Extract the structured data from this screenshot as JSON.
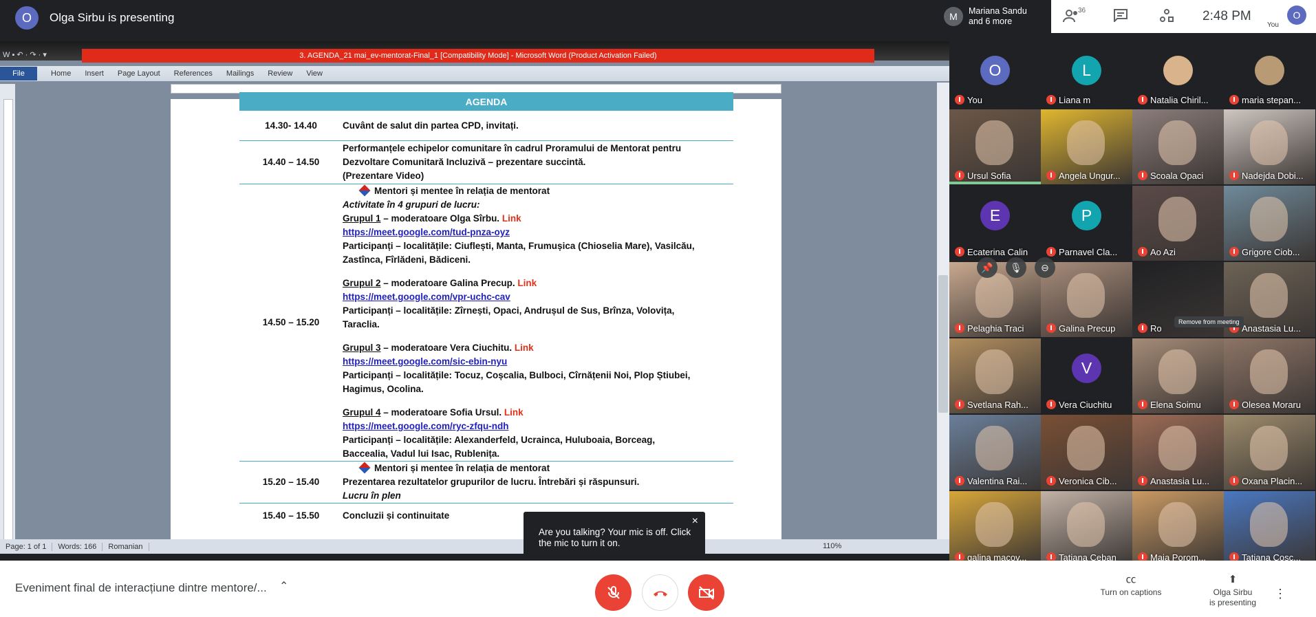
{
  "presenter": {
    "avatar_letter": "O",
    "title": "Olga Sirbu is presenting"
  },
  "header": {
    "joiner_avatar": "M",
    "joiner_line1": "Mariana Sandu",
    "joiner_line2": "and 6 more",
    "people_count": "36",
    "clock": "2:48  PM",
    "you_avatar": "O",
    "you_label": "You",
    "icons": [
      "people-icon",
      "chat-icon",
      "activities-icon"
    ]
  },
  "word": {
    "qat": "W  ▪  ↶ ·  ↷ ·  ▾",
    "title": "3. AGENDA_21 mai_ev-mentorat-Final_1 [Compatibility Mode]  -  Microsoft Word (Product Activation Failed)",
    "tabs": [
      "File",
      "Home",
      "Insert",
      "Page Layout",
      "References",
      "Mailings",
      "Review",
      "View"
    ],
    "status": {
      "page": "Page: 1 of 1",
      "words": "Words: 166",
      "language": "Romanian",
      "zoom": "110%"
    }
  },
  "agenda": {
    "heading": "AGENDA",
    "r1_time": "14.30- 14.40",
    "r1_text": "Cuvânt de salut din partea CPD, invitați.",
    "r2_time": "14.40 – 14.50",
    "r2_l1": "Performanțele echipelor comunitare în cadrul Proramului de Mentorat pentru",
    "r2_l2": "Dezvoltare Comunitară Incluzivă – prezentare succintă.",
    "r2_l3": "(Prezentare Video)",
    "r3_time": "14.50 – 15.20",
    "r3_title": "Mentori și mentee în relația de mentorat",
    "r3_sub": "Activitate în 4 grupuri  de  lucru:",
    "link_word": "Link",
    "groups": [
      {
        "g_name": "Grupul 1",
        "g_mod": " – moderatoare Olga Sîrbu. ",
        "g_url": "https://meet.google.com/tud-pnza-oyz",
        "g_part1": "Participanți – localitățile: Ciuflești, Manta, Frumușica (Chioselia Mare), Vasilcău,",
        "g_part2": "Zastînca, Fîrlădeni, Bădiceni."
      },
      {
        "g_name": "Grupul 2",
        "g_mod": " – moderatoare Galina Precup. ",
        "g_url": "https://meet.google.com/vpr-uchc-cav",
        "g_part1": "Participanți – localitățile: Zîrnești, Opaci, Andrușul de Sus, Brînza, Volovița,",
        "g_part2": "Taraclia."
      },
      {
        "g_name": "Grupul 3",
        "g_mod": " – moderatoare Vera Ciuchitu. ",
        "g_url": "https://meet.google.com/sic-ebin-nyu",
        "g_part1": "Participanți – localitățile: Tocuz, Coșcalia, Bulboci, Cîrnățenii Noi, Plop Știubei,",
        "g_part2": "Hagimus, Ocolina."
      },
      {
        "g_name": "Grupul 4",
        "g_mod": " – moderatoare Sofia Ursul. ",
        "g_url": "https://meet.google.com/ryc-zfqu-ndh",
        "g_part1": "Participanți – localitățile: Alexanderfeld, Ucrainca, Huluboaia, Borceag,",
        "g_part2": "Baccealia, Vadul lui Isac, Rublenița."
      }
    ],
    "r4_time": "15.20 – 15.40",
    "r4_title": "Mentori și mentee în relația de mentorat",
    "r4_l2": "Prezentarea rezultatelor grupurilor de lucru. Întrebări și răspunsuri.",
    "r4_l3": "Lucru în plen",
    "r5_time": "15.40 – 15.50",
    "r5_text": "Concluzii și continuitate"
  },
  "toast": {
    "text": "Are you talking? Your mic is off. Click the mic to turn it on.",
    "close": "×"
  },
  "gallery": {
    "tiles": [
      {
        "name": "You",
        "letter": "O",
        "color": "#5c6bc0"
      },
      {
        "name": "Liana m",
        "letter": "L",
        "color": "#12a4af"
      },
      {
        "name": "Natalia Chiril...",
        "letter": "",
        "color": "#d9b38c"
      },
      {
        "name": "maria stepan...",
        "letter": "",
        "color": "#b89a74"
      },
      {
        "name": "Ursul Sofia",
        "letter": "",
        "color": "#6b5747"
      },
      {
        "name": "Angela Ungur...",
        "letter": "",
        "color": "#e0b62f"
      },
      {
        "name": "Scoala Opaci",
        "letter": "",
        "color": "#8b7d7a"
      },
      {
        "name": "Nadejda Dobi...",
        "letter": "",
        "color": "#cfc6c0"
      },
      {
        "name": "Ecaterina Calin",
        "letter": "E",
        "color": "#5e35b1"
      },
      {
        "name": "Parnavel Cla...",
        "letter": "P",
        "color": "#12a4af"
      },
      {
        "name": "Ao Azi",
        "letter": "",
        "color": "#5b4a48"
      },
      {
        "name": "Grigore Ciob...",
        "letter": "",
        "color": "#6f8a9a"
      },
      {
        "name": "Pelaghia Traci",
        "letter": "",
        "color": "#c9a98f"
      },
      {
        "name": "Galina Precup",
        "letter": "",
        "color": "#a98d7b"
      },
      {
        "name": "Ro",
        "letter": "",
        "color": "#202124"
      },
      {
        "name": "Anastasia Lu...",
        "letter": "",
        "color": "#6d6355"
      },
      {
        "name": "Svetlana Rah...",
        "letter": "",
        "color": "#b08d5e"
      },
      {
        "name": "Vera Ciuchitu",
        "letter": "V",
        "color": "#5e35b1"
      },
      {
        "name": "Elena Soimu",
        "letter": "",
        "color": "#a58b77"
      },
      {
        "name": "Olesea Moraru",
        "letter": "",
        "color": "#8d7466"
      },
      {
        "name": "Valentina Rai...",
        "letter": "",
        "color": "#6a7f9a"
      },
      {
        "name": "Veronica Cib...",
        "letter": "",
        "color": "#7a4f35"
      },
      {
        "name": "Anastasia Lu...",
        "letter": "",
        "color": "#9c6b55"
      },
      {
        "name": "Oxana Placin...",
        "letter": "",
        "color": "#9d8c6d"
      },
      {
        "name": "galina macov...",
        "letter": "",
        "color": "#d7a63a"
      },
      {
        "name": "Tatiana Ceban",
        "letter": "",
        "color": "#c2b2a6"
      },
      {
        "name": "Maia Porom...",
        "letter": "",
        "color": "#c99a63"
      },
      {
        "name": "Tatiana Cosc...",
        "letter": "",
        "color": "#4a78c2"
      }
    ],
    "tooltip": "Remove from meeting"
  },
  "bottom": {
    "meeting_title": "Eveniment final de interacțiune dintre mentore/...",
    "captions_label": "Turn on captions",
    "present_line1": "Olga Sirbu",
    "present_line2": "is presenting"
  },
  "colors": {
    "accent": "#ea4335",
    "agenda_header": "#4bacc6",
    "word_title": "#e02a1a"
  }
}
